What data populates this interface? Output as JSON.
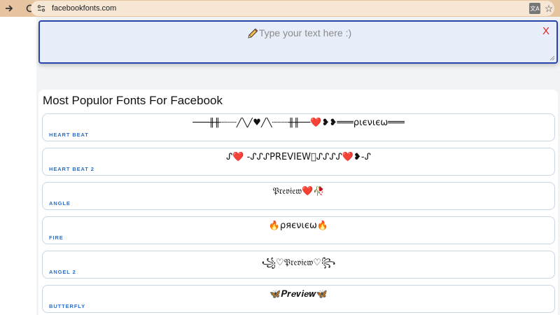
{
  "browser": {
    "url": "facebookfonts.com",
    "icons": [
      "forward-icon",
      "reload-icon",
      "site-info-icon",
      "translate-icon",
      "bookmark-star-icon"
    ]
  },
  "editor": {
    "placeholder": "Type your text here :)",
    "pencil_icon": "pencil-icon",
    "clear_label": "X",
    "clear_color": "#e02020",
    "border_color": "#2545a8"
  },
  "fonts_panel": {
    "title": "Most Populor Fonts For Facebook",
    "cards": [
      {
        "label": "HEART BEAT",
        "preview": "───╫╫┈┈┈╱╲╱♥╱╲┈┈┈╫╫──❤️❥❥═══ριєνιєω═══"
      },
      {
        "label": "HEART BEAT 2",
        "preview": "ᔑ❤️ -ᔑᔑᔑPREVIEW⃠ᔑᔑᔑᔑ❤️❥-ᔑ"
      },
      {
        "label": "ANGLE",
        "preview": "𝔓𝔯𝔢𝔳𝔦𝔢𝔴❤️🥀"
      },
      {
        "label": "FIRE",
        "preview": "🔥ρяєνιєω🔥"
      },
      {
        "label": "ANGEL 2",
        "preview": "꧁♡𝔓𝔯𝔢𝔳𝔦𝔢𝔴♡꧂"
      },
      {
        "label": "BUTTERFLY",
        "preview": "🦋𝑷𝒓𝒆𝒗𝒊𝒆𝒘🦋"
      }
    ],
    "label_color": "#2a6fc9"
  }
}
